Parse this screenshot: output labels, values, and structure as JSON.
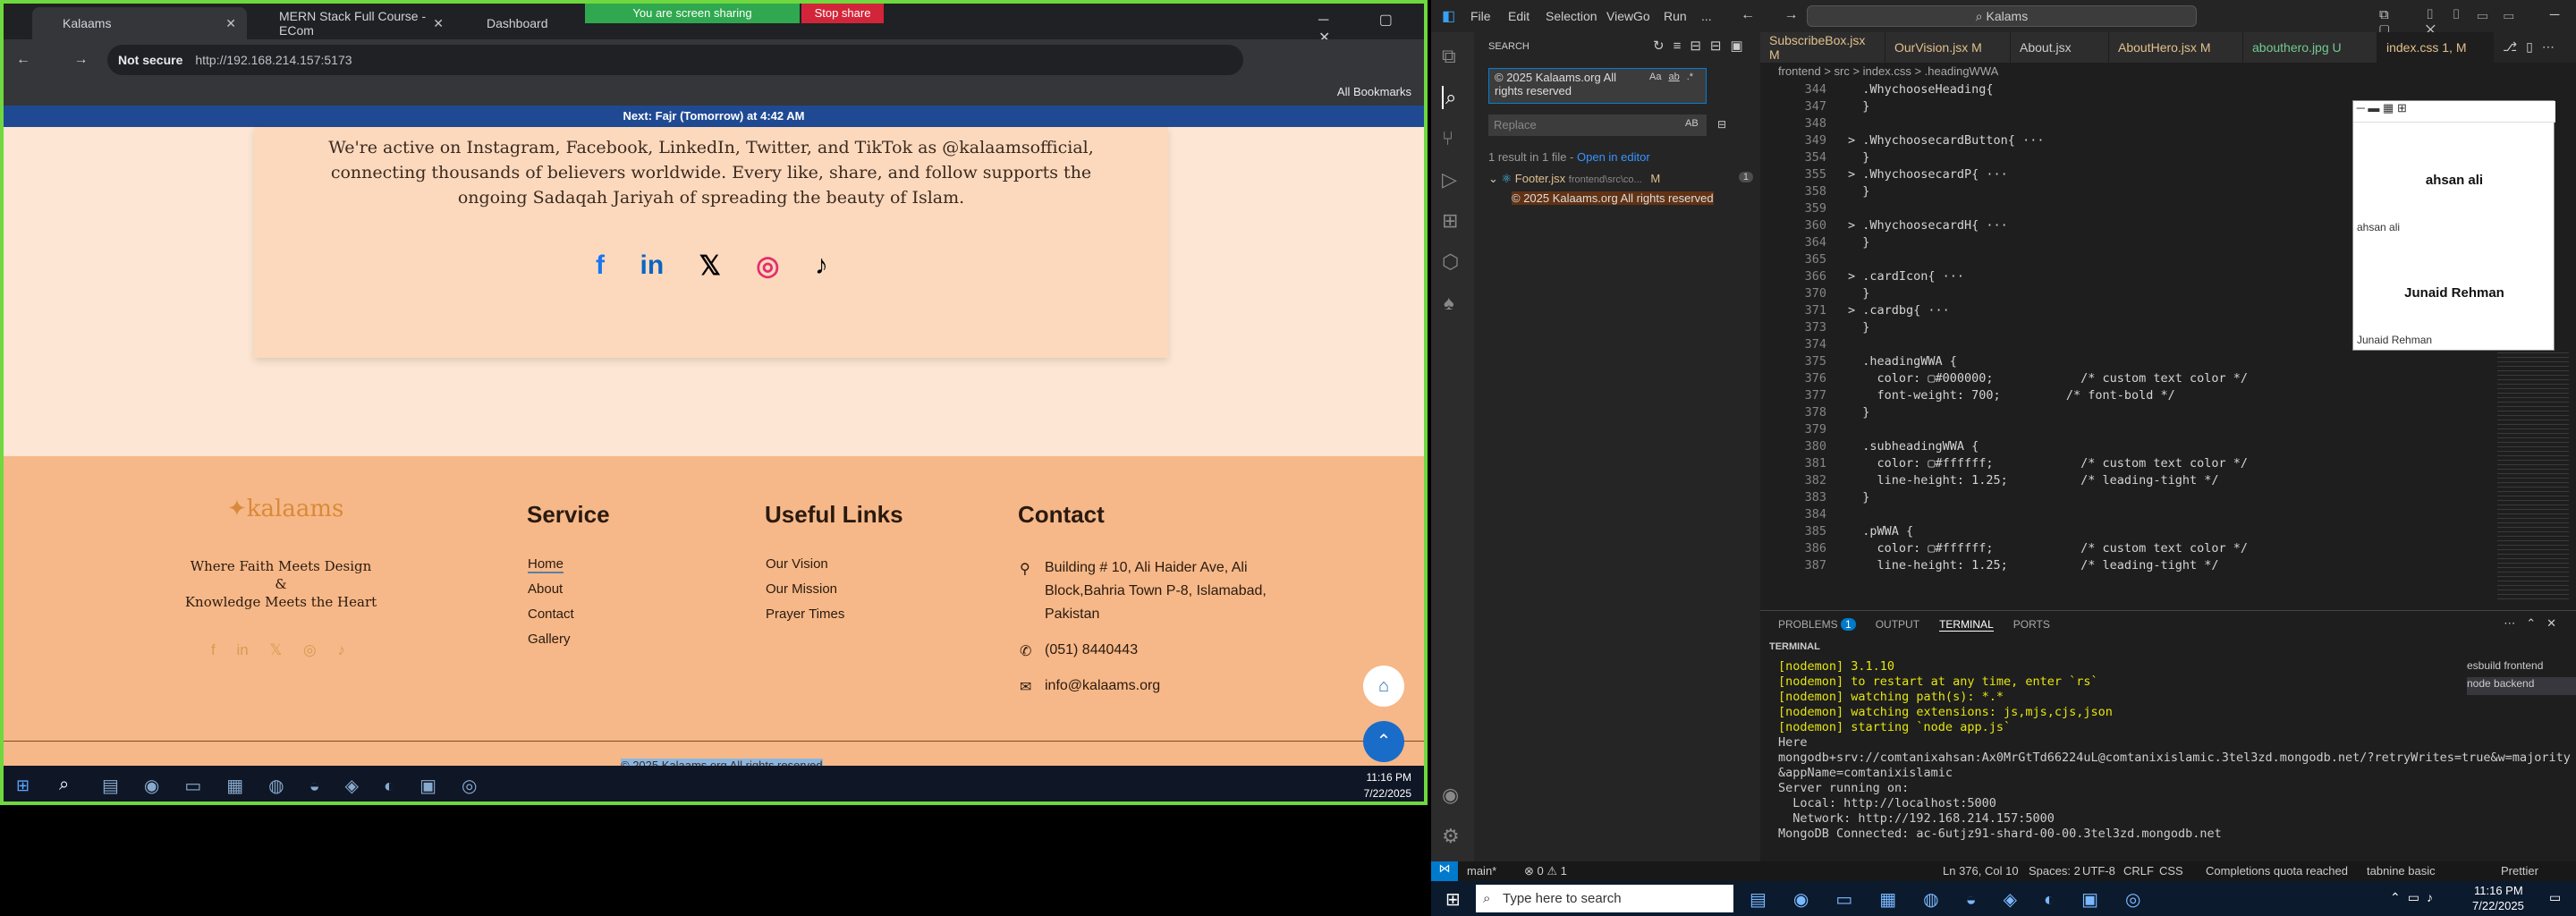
{
  "browser": {
    "tabs": [
      {
        "label": "Kalaams"
      },
      {
        "label": "MERN Stack Full Course - ECom"
      },
      {
        "label": "Dashboard"
      }
    ],
    "share_text": "You are screen sharing",
    "stop_share": "Stop share",
    "not_secure": "Not secure",
    "url": "http://192.168.214.157:5173",
    "all_bookmarks": "All Bookmarks"
  },
  "site": {
    "next_prayer": "Next: Fajr (Tomorrow) at 4:42 AM",
    "card_text": [
      "We're active on Instagram, Facebook, LinkedIn, Twitter, and TikTok as @kalaamsofficial,",
      "connecting thousands of believers worldwide. Every like, share, and follow supports the",
      "ongoing Sadaqah Jariyah of spreading the beauty of Islam."
    ],
    "logo": "kalaams",
    "tagline": [
      "Where Faith Meets Design",
      "&",
      "Knowledge Meets the Heart"
    ],
    "service_title": "Service",
    "service_links": [
      "Home",
      "About",
      "Contact",
      "Gallery"
    ],
    "useful_title": "Useful Links",
    "useful_links": [
      "Our Vision",
      "Our Mission",
      "Prayer Times"
    ],
    "contact_title": "Contact",
    "address": [
      "Building # 10, Ali Haider Ave, Ali",
      "Block,Bahria Town P-8, Islamabad,",
      "Pakistan"
    ],
    "phone": "(051) 8440443",
    "email": "info@kalaams.org",
    "copyright": "© 2025 Kalaams.org All rights reserved"
  },
  "left_taskbar": {
    "time": "11:16 PM",
    "date": "7/22/2025"
  },
  "vscode": {
    "menu": [
      "File",
      "Edit",
      "Selection",
      "View",
      "Go",
      "Run",
      "..."
    ],
    "search_box": "Kalams",
    "search_title": "SEARCH",
    "search_query": [
      "© 2025 Kalaams.org All",
      "rights reserved"
    ],
    "replace_placeholder": "Replace",
    "aa": "Aa",
    "ab": "ab",
    "all": "AB",
    "results": "1 result in 1 file - ",
    "open_in_editor": "Open in editor",
    "result_file": "Footer.jsx",
    "result_path": "frontend\\src\\co...",
    "result_badge": "M",
    "result_count": "1",
    "result_match": "© 2025 Kalaams.org All rights reserved",
    "tabs": [
      "SubscribeBox.jsx M",
      "OurVision.jsx M",
      "About.jsx",
      "AboutHero.jsx M",
      "abouthero.jpg U",
      "index.css 1, M"
    ],
    "breadcrumb": "frontend > src > index.css > .headingWWA",
    "lines": [
      {
        "n": "344",
        "t": "  .WhychooseHeading{"
      },
      {
        "n": "347",
        "t": "  }"
      },
      {
        "n": "348",
        "t": ""
      },
      {
        "n": "349",
        "t": "> .WhychoosecardButton{ ···"
      },
      {
        "n": "354",
        "t": "  }"
      },
      {
        "n": "355",
        "t": "> .WhychoosecardP{ ···"
      },
      {
        "n": "358",
        "t": "  }"
      },
      {
        "n": "359",
        "t": ""
      },
      {
        "n": "360",
        "t": "> .WhychoosecardH{ ···"
      },
      {
        "n": "364",
        "t": "  }"
      },
      {
        "n": "365",
        "t": ""
      },
      {
        "n": "366",
        "t": "> .cardIcon{ ···"
      },
      {
        "n": "370",
        "t": "  }"
      },
      {
        "n": "371",
        "t": "> .cardbg{ ···"
      },
      {
        "n": "373",
        "t": "  }"
      },
      {
        "n": "374",
        "t": ""
      },
      {
        "n": "375",
        "t": "  .headingWWA {"
      },
      {
        "n": "376",
        "t": "    color: ▢#000000;            /* custom text color */"
      },
      {
        "n": "377",
        "t": "    font-weight: 700;         /* font-bold */"
      },
      {
        "n": "378",
        "t": "  }"
      },
      {
        "n": "379",
        "t": ""
      },
      {
        "n": "380",
        "t": "  .subheadingWWA {"
      },
      {
        "n": "381",
        "t": "    color: ▢#ffffff;            /* custom text color */"
      },
      {
        "n": "382",
        "t": "    line-height: 1.25;          /* leading-tight */"
      },
      {
        "n": "383",
        "t": "  }"
      },
      {
        "n": "384",
        "t": ""
      },
      {
        "n": "385",
        "t": "  .pWWA {"
      },
      {
        "n": "386",
        "t": "    color: ▢#ffffff;            /* custom text color */"
      },
      {
        "n": "387",
        "t": "    line-height: 1.25;          /* leading-tight */"
      }
    ],
    "popup_names": [
      "ahsan ali",
      "ahsan ali",
      "Junaid Rehman",
      "Junaid Rehman"
    ],
    "panel_tabs": [
      "PROBLEMS",
      "1",
      "OUTPUT",
      "TERMINAL",
      "PORTS"
    ],
    "terminal_label": "TERMINAL",
    "terminal": [
      "[nodemon] 3.1.10",
      "[nodemon] to restart at any time, enter `rs`",
      "[nodemon] watching path(s): *.*",
      "[nodemon] watching extensions: js,mjs,cjs,json",
      "[nodemon] starting `node app.js`",
      "Here",
      "mongodb+srv://comtanixahsan:Ax0MrGtTd66224uL@comtanixislamic.3tel3zd.mongodb.net/?retryWrites=true&w=majority",
      "&appName=comtanixislamic",
      "Server running on:",
      "  Local: http://localhost:5000",
      "  Network: http://192.168.214.157:5000",
      "MongoDB Connected: ac-6utjz91-shard-00-00.3tel3zd.mongodb.net"
    ],
    "term_list": [
      "esbuild frontend",
      "node backend"
    ],
    "status_left": [
      "main*",
      "⊗ 0 ⚠ 1"
    ],
    "status_right": [
      "Ln 376, Col 10",
      "Spaces: 2",
      "UTF-8",
      "CRLF",
      "CSS",
      "Completions quota reached",
      "tabnine basic",
      "Prettier"
    ]
  },
  "right_taskbar": {
    "search": "Type here to search",
    "time": "11:16 PM",
    "date": "7/22/2025"
  }
}
